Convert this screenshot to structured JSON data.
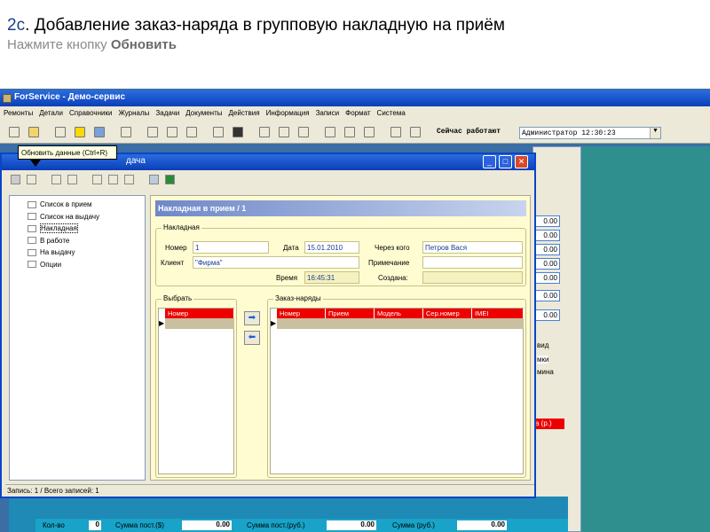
{
  "slide": {
    "number": "2с",
    "title": ". Добавление заказ-наряда в групповую накладную  на приём",
    "subtitle_prefix": "Нажмите кнопку ",
    "subtitle_bold": "Обновить"
  },
  "app": {
    "title": "ForService - Демо-сервис"
  },
  "menu": [
    "Ремонты",
    "Детали",
    "Справочники",
    "Журналы",
    "Задачи",
    "Документы",
    "Действия",
    "Информация",
    "Записи",
    "Формат",
    "Система"
  ],
  "toolbar": {
    "now_working_label": "Сейчас работают",
    "user_combo": "Администратор 12:30:23"
  },
  "window": {
    "title": "дача",
    "tooltip": "Обновить данные (Ctrl+R)"
  },
  "tree": [
    "Список в прием",
    "Список на выдачу",
    "Накладная",
    "В работе",
    "На выдачу",
    "Опции"
  ],
  "invoice": {
    "header": "Накладная в прием / 1",
    "group_title": "Накладная",
    "number_label": "Номер",
    "number": "1",
    "date_label": "Дата",
    "date": "15.01.2010",
    "via_label": "Через кого",
    "via": "Петров Вася",
    "client_label": "Клиент",
    "client": "\"Фирма\"",
    "note_label": "Примечание",
    "note": "",
    "time_label": "Время",
    "time": "16:45:31",
    "created_label": "Создана:",
    "created": ""
  },
  "select_panel": {
    "title": "Выбрать",
    "columns": [
      "Номер"
    ]
  },
  "orders_panel": {
    "title": "Заказ-наряды",
    "columns": [
      "Номер",
      "Прием",
      "Модель",
      "Сер.номер",
      "IMEI"
    ]
  },
  "status": "Запись: 1 / Всего записей: 1",
  "background": {
    "values": [
      "0.00",
      "0.00",
      "0.00",
      "0.00",
      "0.00",
      "0.00",
      "0.00"
    ],
    "texts": [
      "вид",
      "мки",
      "мина"
    ],
    "red_label": "а (р.)"
  },
  "stats": {
    "qty_label": "Кол-во",
    "qty": "0",
    "sum_usd_label": "Сумма пост.($)",
    "sum_usd": "0.00",
    "sum_rub_label": "Сумма пост.(руб.)",
    "sum_rub": "0.00",
    "sum_label": "Сумма (руб.)",
    "sum": "0.00"
  },
  "colors": {
    "accent": "#0a45c8",
    "grid_header": "#e00000",
    "panel": "#fefcd0"
  }
}
